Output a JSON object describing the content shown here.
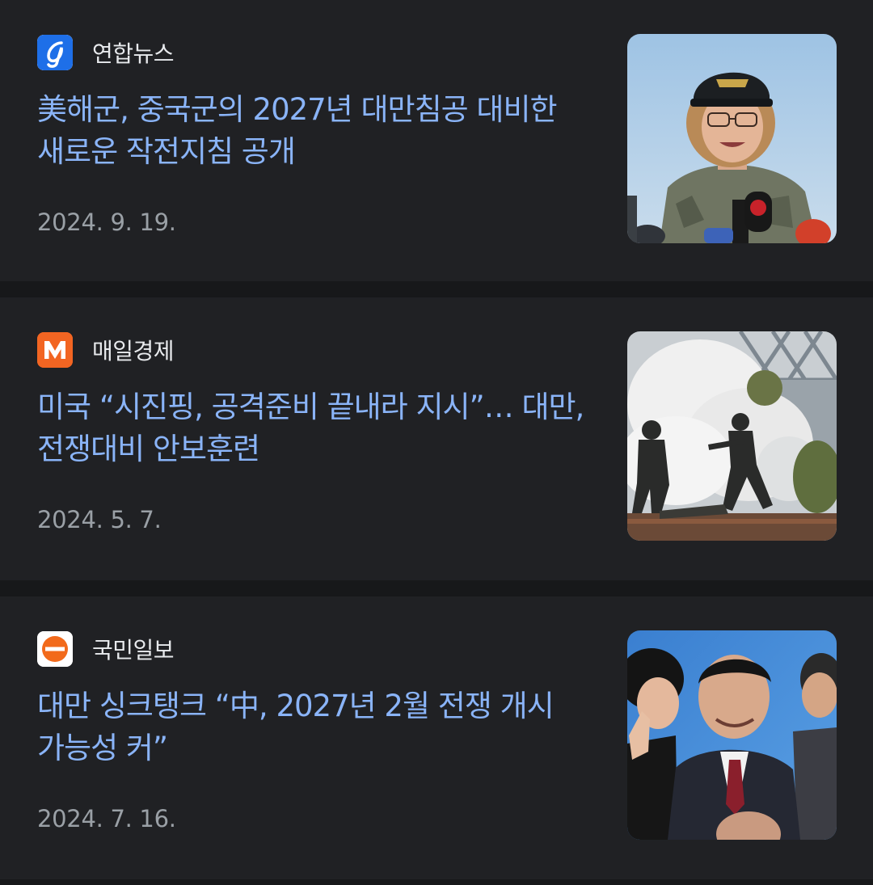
{
  "articles": [
    {
      "source": "연합뉴스",
      "source_logo_icon": "yonhap-logo-icon",
      "title": "美해군, 중국군의 2027년 대만침공 대비한 새로운 작전지침 공개",
      "date": "2024. 9. 19.",
      "thumbnail": "navy-officer-press-photo"
    },
    {
      "source": "매일경제",
      "source_logo_icon": "maeil-m-logo-icon",
      "title": "미국 “시진핑, 공격준비 끝내라 지시”… 대만, 전쟁대비 안보훈련",
      "date": "2024. 5. 7.",
      "thumbnail": "military-drill-smoke-photo"
    },
    {
      "source": "국민일보",
      "source_logo_icon": "kukmin-logo-icon",
      "title": "대만 싱크탱크 “中, 2027년 2월 전쟁 개시 가능성 커”",
      "date": "2024. 7. 16.",
      "thumbnail": "xi-jinping-event-photo"
    }
  ],
  "colors": {
    "background": "#202124",
    "divider": "#17181a",
    "headline": "#8ab4f8",
    "source": "#e8eaed",
    "date": "#9aa0a6"
  }
}
